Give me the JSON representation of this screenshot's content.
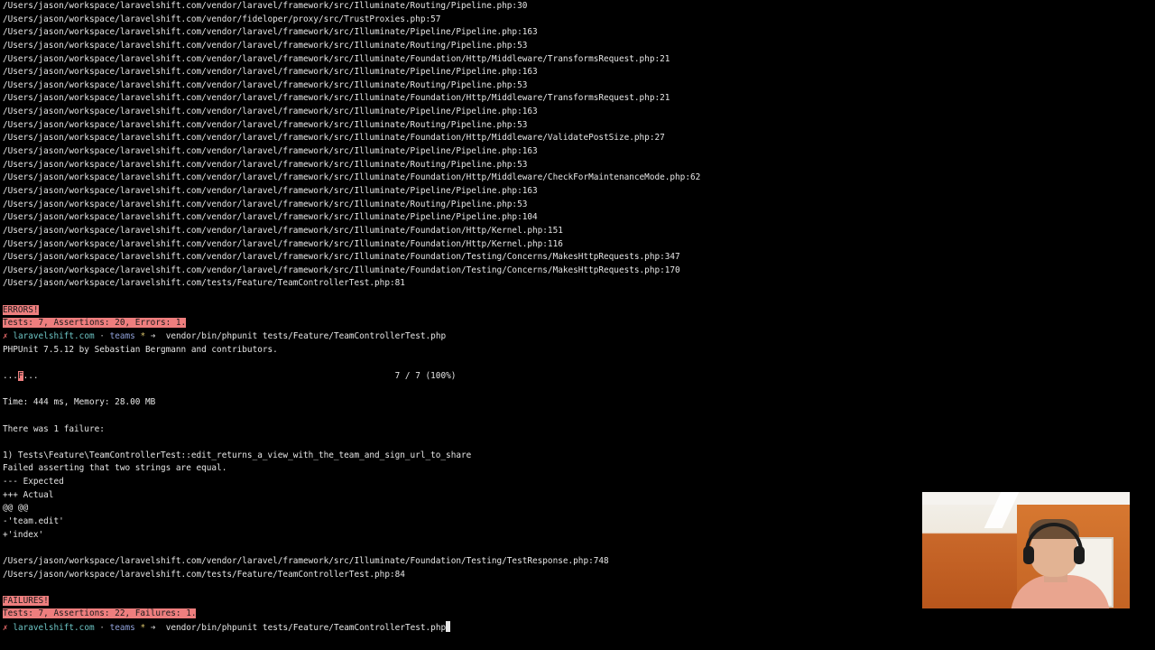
{
  "terminal": {
    "stack_trace_top": [
      "/Users/jason/workspace/laravelshift.com/vendor/laravel/framework/src/Illuminate/Routing/Pipeline.php:30",
      "/Users/jason/workspace/laravelshift.com/vendor/fideloper/proxy/src/TrustProxies.php:57",
      "/Users/jason/workspace/laravelshift.com/vendor/laravel/framework/src/Illuminate/Pipeline/Pipeline.php:163",
      "/Users/jason/workspace/laravelshift.com/vendor/laravel/framework/src/Illuminate/Routing/Pipeline.php:53",
      "/Users/jason/workspace/laravelshift.com/vendor/laravel/framework/src/Illuminate/Foundation/Http/Middleware/TransformsRequest.php:21",
      "/Users/jason/workspace/laravelshift.com/vendor/laravel/framework/src/Illuminate/Pipeline/Pipeline.php:163",
      "/Users/jason/workspace/laravelshift.com/vendor/laravel/framework/src/Illuminate/Routing/Pipeline.php:53",
      "/Users/jason/workspace/laravelshift.com/vendor/laravel/framework/src/Illuminate/Foundation/Http/Middleware/TransformsRequest.php:21",
      "/Users/jason/workspace/laravelshift.com/vendor/laravel/framework/src/Illuminate/Pipeline/Pipeline.php:163",
      "/Users/jason/workspace/laravelshift.com/vendor/laravel/framework/src/Illuminate/Routing/Pipeline.php:53",
      "/Users/jason/workspace/laravelshift.com/vendor/laravel/framework/src/Illuminate/Foundation/Http/Middleware/ValidatePostSize.php:27",
      "/Users/jason/workspace/laravelshift.com/vendor/laravel/framework/src/Illuminate/Pipeline/Pipeline.php:163",
      "/Users/jason/workspace/laravelshift.com/vendor/laravel/framework/src/Illuminate/Routing/Pipeline.php:53",
      "/Users/jason/workspace/laravelshift.com/vendor/laravel/framework/src/Illuminate/Foundation/Http/Middleware/CheckForMaintenanceMode.php:62",
      "/Users/jason/workspace/laravelshift.com/vendor/laravel/framework/src/Illuminate/Pipeline/Pipeline.php:163",
      "/Users/jason/workspace/laravelshift.com/vendor/laravel/framework/src/Illuminate/Routing/Pipeline.php:53",
      "/Users/jason/workspace/laravelshift.com/vendor/laravel/framework/src/Illuminate/Pipeline/Pipeline.php:104",
      "/Users/jason/workspace/laravelshift.com/vendor/laravel/framework/src/Illuminate/Foundation/Http/Kernel.php:151",
      "/Users/jason/workspace/laravelshift.com/vendor/laravel/framework/src/Illuminate/Foundation/Http/Kernel.php:116",
      "/Users/jason/workspace/laravelshift.com/vendor/laravel/framework/src/Illuminate/Foundation/Testing/Concerns/MakesHttpRequests.php:347",
      "/Users/jason/workspace/laravelshift.com/vendor/laravel/framework/src/Illuminate/Foundation/Testing/Concerns/MakesHttpRequests.php:170",
      "/Users/jason/workspace/laravelshift.com/tests/Feature/TeamControllerTest.php:81"
    ],
    "errors_label": "ERRORS!",
    "errors_summary": "Tests: 7, Assertions: 20, Errors: 1.",
    "prompt1": {
      "x": "✗",
      "host": "laravelshift.com",
      "sep": " · ",
      "branch": "teams",
      "star": " * ",
      "arrow": "➜",
      "command": "vendor/bin/phpunit tests/Feature/TeamControllerTest.php"
    },
    "phpunit_version": "PHPUnit 7.5.12 by Sebastian Bergmann and contributors.",
    "progress_prefix": "...",
    "progress_fail": "F",
    "progress_suffix": "...",
    "progress_count": "7 / 7 (100%)",
    "time_memory": "Time: 444 ms, Memory: 28.00 MB",
    "failure_heading": "There was 1 failure:",
    "failure_test": "1) Tests\\Feature\\TeamControllerTest::edit_returns_a_view_with_the_team_and_sign_url_to_share",
    "failure_message": "Failed asserting that two strings are equal.",
    "diff_expected": "--- Expected",
    "diff_actual": "+++ Actual",
    "diff_hunk": "@@ @@",
    "diff_minus": "-'team.edit'",
    "diff_plus": "+'index'",
    "failure_trace": [
      "/Users/jason/workspace/laravelshift.com/vendor/laravel/framework/src/Illuminate/Foundation/Testing/TestResponse.php:748",
      "/Users/jason/workspace/laravelshift.com/tests/Feature/TeamControllerTest.php:84"
    ],
    "failures_label": "FAILURES!",
    "failures_summary": "Tests: 7, Assertions: 22, Failures: 1.",
    "prompt2": {
      "x": "✗",
      "host": "laravelshift.com",
      "sep": " · ",
      "branch": "teams",
      "star": " * ",
      "arrow": "➜",
      "command": "vendor/bin/phpunit tests/Feature/TeamControllerTest.php"
    }
  },
  "colors": {
    "background": "#000000",
    "text": "#e6e6e6",
    "highlight": "#ee7e7e",
    "prompt_x": "#e86a6a",
    "prompt_host": "#6cc4c4"
  }
}
